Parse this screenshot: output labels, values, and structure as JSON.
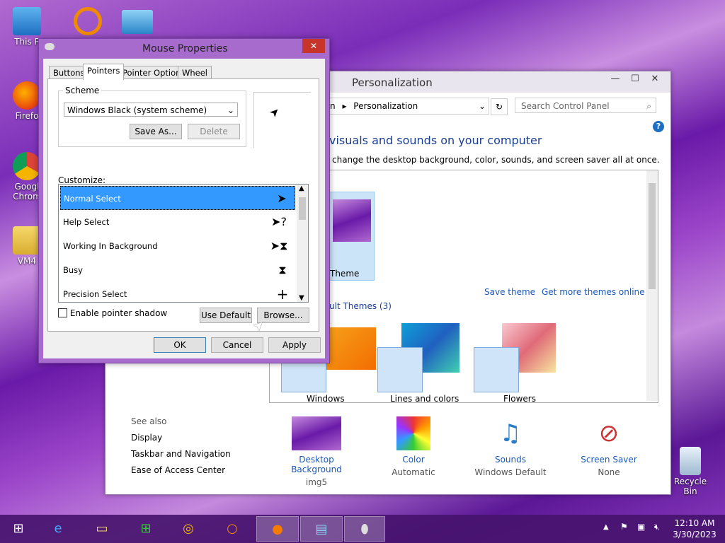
{
  "desktop": {
    "icons": [
      {
        "label": "This P"
      },
      {
        "label": "Firefo"
      },
      {
        "label": "Googl Chrom"
      },
      {
        "label": "VM4"
      },
      {
        "label": "Recycle Bin"
      }
    ]
  },
  "personalization": {
    "title": "Personalization",
    "breadcrumb": [
      "n",
      "Personalization"
    ],
    "search_placeholder": "Search Control Panel",
    "heading": "visuals and sounds on your computer",
    "subheading": "change the desktop background, color, sounds, and screen saver all at once.",
    "current_theme_label": "Theme",
    "save_theme": "Save theme",
    "get_more": "Get more themes online",
    "default_themes": "ult Themes (3)",
    "themes": [
      "Windows",
      "Lines and colors",
      "Flowers"
    ],
    "see_also_title": "See also",
    "see_also": [
      "Display",
      "Taskbar and Navigation",
      "Ease of Access Center"
    ],
    "bottom": [
      {
        "title": "Desktop Background",
        "value": "img5"
      },
      {
        "title": "Color",
        "value": "Automatic"
      },
      {
        "title": "Sounds",
        "value": "Windows Default"
      },
      {
        "title": "Screen Saver",
        "value": "None"
      }
    ]
  },
  "mouse": {
    "title": "Mouse Properties",
    "tabs": [
      "Buttons",
      "Pointers",
      "Pointer Options",
      "Wheel"
    ],
    "scheme_label": "Scheme",
    "scheme_value": "Windows Black (system scheme)",
    "save_as": "Save As...",
    "delete": "Delete",
    "customize_label": "Customize:",
    "pointers": [
      {
        "name": "Normal Select",
        "glyph": "➤"
      },
      {
        "name": "Help Select",
        "glyph": "➤?"
      },
      {
        "name": "Working In Background",
        "glyph": "➤⧗"
      },
      {
        "name": "Busy",
        "glyph": "⧗"
      },
      {
        "name": "Precision Select",
        "glyph": "+"
      }
    ],
    "shadow_label": "Enable pointer shadow",
    "use_default": "Use Default",
    "browse": "Browse...",
    "ok": "OK",
    "cancel": "Cancel",
    "apply": "Apply"
  },
  "taskbar": {
    "time": "12:10 AM",
    "date": "3/30/2023"
  },
  "colors": {
    "accent": "#a66bcc",
    "selection": "#3399ff",
    "link": "#1a57b8"
  }
}
